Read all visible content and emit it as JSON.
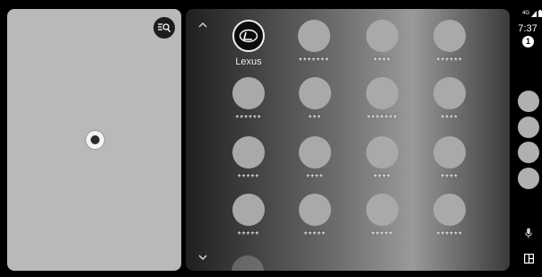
{
  "map": {
    "search_icon": "search-list-icon",
    "location_icon": "current-location-icon"
  },
  "launcher": {
    "scroll_up_icon": "chevron-up-icon",
    "scroll_down_icon": "chevron-down-icon",
    "apps": [
      {
        "label": "Lexus",
        "icon": "lexus-logo-icon"
      },
      {
        "label": "*******"
      },
      {
        "label": "****"
      },
      {
        "label": "******"
      },
      {
        "label": "******"
      },
      {
        "label": "***"
      },
      {
        "label": "*******"
      },
      {
        "label": "****"
      },
      {
        "label": "*****"
      },
      {
        "label": "****"
      },
      {
        "label": "****"
      },
      {
        "label": "****"
      },
      {
        "label": "*****"
      },
      {
        "label": "*****"
      },
      {
        "label": "*****"
      },
      {
        "label": "******"
      }
    ]
  },
  "status_bar": {
    "signal": "4G",
    "time": "7:37",
    "notification_count": "1"
  },
  "rail": {
    "mic_icon": "microphone-icon",
    "grid_icon": "app-grid-icon"
  }
}
